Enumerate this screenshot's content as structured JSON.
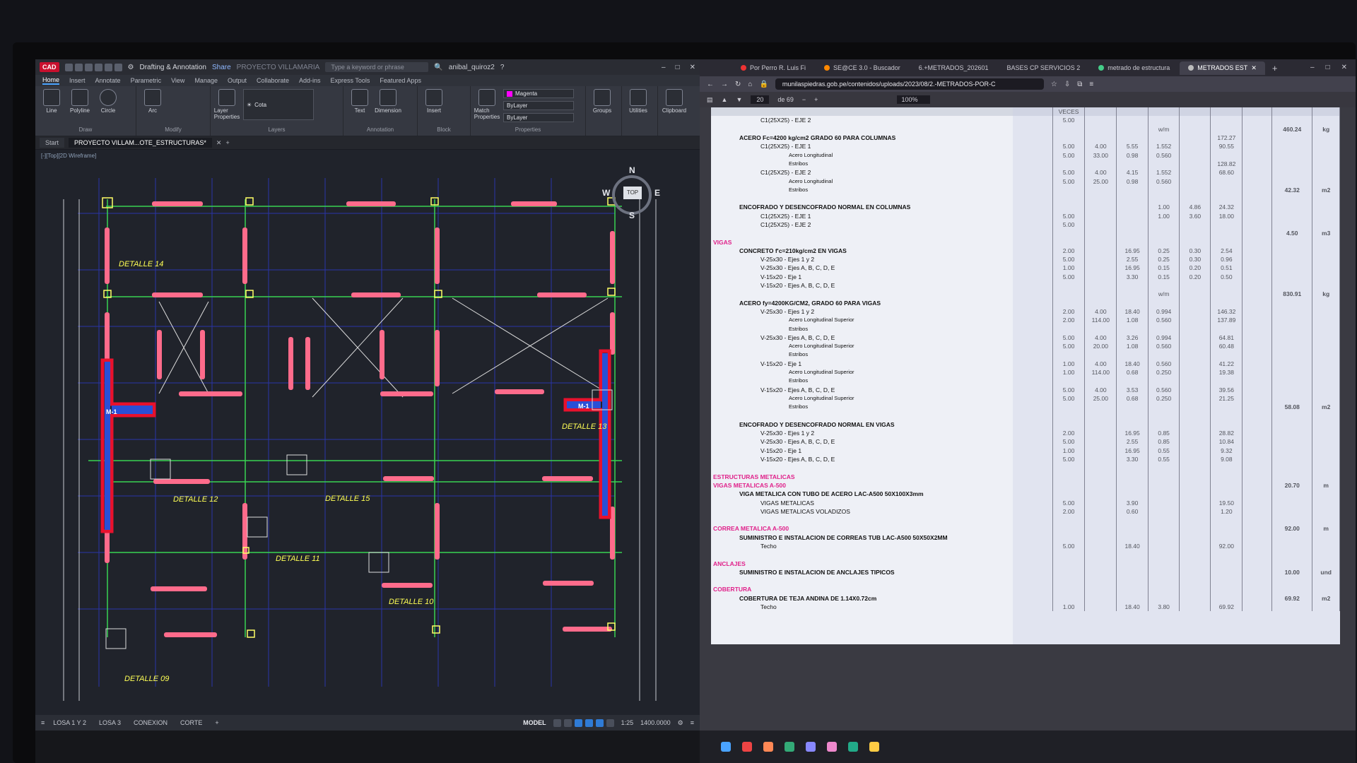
{
  "cad": {
    "app_badge": "CAD",
    "workspace": "Drafting & Annotation",
    "share": "Share",
    "file_title": "PROYECTO VILLAMARIA",
    "search_placeholder": "Type a keyword or phrase",
    "user": "anibal_quiroz2",
    "ribbon_tabs": [
      "Home",
      "Insert",
      "Annotate",
      "Parametric",
      "View",
      "Manage",
      "Output",
      "Collaborate",
      "Add-ins",
      "Express Tools",
      "Featured Apps"
    ],
    "draw_tools": [
      "Line",
      "Polyline",
      "Circle",
      "Arc"
    ],
    "group_draw": "Draw",
    "group_modify": "Modify",
    "layer_props": "Layer Properties",
    "layer_name": "Cota",
    "group_layers": "Layers",
    "annot_tools": [
      "Text",
      "Dimension"
    ],
    "group_annotation": "Annotation",
    "insert_label": "Insert",
    "group_block": "Block",
    "match_props": "Match Properties",
    "color_value": "Magenta",
    "bylayer1": "ByLayer",
    "bylayer2": "ByLayer",
    "group_properties": "Properties",
    "groups_label": "Groups",
    "utilities_label": "Utilities",
    "clipboard_label": "Clipboard",
    "doc_tab_start": "Start",
    "doc_tab_file": "PROYECTO VILLAM...OTE_ESTRUCTURAS*",
    "viewport_label": "[-][Top][2D Wireframe]",
    "details": [
      "DETALLE 14",
      "DETALLE 13",
      "DETALLE 12",
      "DETALLE 15",
      "DETALLE 11",
      "DETALLE 10",
      "DETALLE 09"
    ],
    "wall_label_left": "M-1",
    "wall_label_right": "M-1",
    "compass": {
      "n": "N",
      "s": "S",
      "e": "E",
      "w": "W",
      "top": "TOP"
    },
    "layout_tabs": [
      "LOSA 1 Y 2",
      "LOSA 3",
      "CONEXION",
      "CORTE"
    ],
    "model": "MODEL",
    "scale": "1:25",
    "coord": "1400.0000"
  },
  "browser": {
    "tabs": [
      "Por Perro R. Luis Fi",
      "SE@CE 3.0 - Buscador",
      "6.+METRADOS_202601",
      "BASES CP SERVICIOS 2",
      "metrado de estructura",
      "METRADOS EST"
    ],
    "url": "munilaspiedras.gob.pe/contenidos/uploads/2023/08/2.-METRADOS-POR-C",
    "page_current": "20",
    "page_total": "de 69",
    "zoom": "100%",
    "header_cols": [
      "VECES"
    ]
  },
  "sheet": {
    "rows": [
      {
        "d": "C1(25X25) - EJE 2",
        "l": "lvl2",
        "c": [
          "5.00",
          "",
          "",
          "",
          "",
          "",
          ""
        ],
        "t": "",
        "u": ""
      },
      {
        "d": "",
        "l": "",
        "c": [
          "",
          "",
          "",
          "w/m",
          "",
          "",
          ""
        ],
        "t": "460.24",
        "u": "kg"
      },
      {
        "d": "ACERO Fc=4200 kg/cm2 GRADO 60 PARA COLUMNAS",
        "l": "lvl1",
        "c": [
          "",
          "",
          "",
          "",
          "",
          "172.27",
          ""
        ],
        "t": "",
        "u": ""
      },
      {
        "d": "C1(25X25) - EJE 1",
        "l": "lvl2",
        "c": [
          "5.00",
          "4.00",
          "5.55",
          "1.552",
          "",
          "90.55",
          ""
        ],
        "t": "",
        "u": ""
      },
      {
        "d": "Acero Longitudinal",
        "l": "lvl3",
        "c": [
          "5.00",
          "33.00",
          "0.98",
          "0.560",
          "",
          "",
          ""
        ],
        "t": "",
        "u": ""
      },
      {
        "d": "Estribos",
        "l": "lvl3",
        "c": [
          "",
          "",
          "",
          "",
          "",
          "128.82",
          ""
        ],
        "t": "",
        "u": ""
      },
      {
        "d": "C1(25X25) - EJE 2",
        "l": "lvl2",
        "c": [
          "5.00",
          "4.00",
          "4.15",
          "1.552",
          "",
          "68.60",
          ""
        ],
        "t": "",
        "u": ""
      },
      {
        "d": "Acero Longitudinal",
        "l": "lvl3",
        "c": [
          "5.00",
          "25.00",
          "0.98",
          "0.560",
          "",
          "",
          ""
        ],
        "t": "",
        "u": ""
      },
      {
        "d": "Estribos",
        "l": "lvl3",
        "c": [
          "",
          "",
          "",
          "",
          "",
          "",
          ""
        ],
        "t": "42.32",
        "u": "m2"
      },
      {
        "d": "",
        "l": "",
        "c": [
          "",
          "",
          "",
          "",
          "",
          "",
          ""
        ],
        "t": "",
        "u": ""
      },
      {
        "d": "ENCOFRADO Y DESENCOFRADO NORMAL EN COLUMNAS",
        "l": "lvl1",
        "c": [
          "",
          "",
          "",
          "1.00",
          "4.86",
          "24.32",
          ""
        ],
        "t": "",
        "u": ""
      },
      {
        "d": "C1(25X25) - EJE 1",
        "l": "lvl2",
        "c": [
          "5.00",
          "",
          "",
          "1.00",
          "3.60",
          "18.00",
          ""
        ],
        "t": "",
        "u": ""
      },
      {
        "d": "C1(25X25) - EJE 2",
        "l": "lvl2",
        "c": [
          "5.00",
          "",
          "",
          "",
          "",
          "",
          ""
        ],
        "t": "",
        "u": ""
      },
      {
        "d": "",
        "l": "",
        "c": [
          "",
          "",
          "",
          "",
          "",
          "",
          ""
        ],
        "t": "4.50",
        "u": "m3"
      },
      {
        "d": "VIGAS",
        "l": "lvl0",
        "c": [
          "",
          "",
          "",
          "",
          "",
          "",
          ""
        ],
        "t": "",
        "u": ""
      },
      {
        "d": "CONCRETO f'c=210kg/cm2 EN VIGAS",
        "l": "lvl1",
        "c": [
          "2.00",
          "",
          "16.95",
          "0.25",
          "0.30",
          "2.54",
          ""
        ],
        "t": "",
        "u": ""
      },
      {
        "d": "V-25x30 - Ejes 1 y 2",
        "l": "lvl2",
        "c": [
          "5.00",
          "",
          "2.55",
          "0.25",
          "0.30",
          "0.96",
          ""
        ],
        "t": "",
        "u": ""
      },
      {
        "d": "V-25x30 - Ejes A, B, C, D, E",
        "l": "lvl2",
        "c": [
          "1.00",
          "",
          "16.95",
          "0.15",
          "0.20",
          "0.51",
          ""
        ],
        "t": "",
        "u": ""
      },
      {
        "d": "V-15x20 - Eje 1",
        "l": "lvl2",
        "c": [
          "5.00",
          "",
          "3.30",
          "0.15",
          "0.20",
          "0.50",
          ""
        ],
        "t": "",
        "u": ""
      },
      {
        "d": "V-15x20 - Ejes A, B, C, D, E",
        "l": "lvl2",
        "c": [
          "",
          "",
          "",
          "",
          "",
          "",
          ""
        ],
        "t": "",
        "u": ""
      },
      {
        "d": "",
        "l": "",
        "c": [
          "",
          "",
          "",
          "w/m",
          "",
          "",
          ""
        ],
        "t": "830.91",
        "u": "kg"
      },
      {
        "d": "ACERO fy=4200KG/CM2, GRADO 60 PARA VIGAS",
        "l": "lvl1",
        "c": [
          "",
          "",
          "",
          "",
          "",
          "",
          ""
        ],
        "t": "",
        "u": ""
      },
      {
        "d": "V-25x30 - Ejes 1 y 2",
        "l": "lvl2",
        "c": [
          "2.00",
          "4.00",
          "18.40",
          "0.994",
          "",
          "146.32",
          ""
        ],
        "t": "",
        "u": ""
      },
      {
        "d": "Acero Longitudinal Superior",
        "l": "lvl3",
        "c": [
          "2.00",
          "114.00",
          "1.08",
          "0.560",
          "",
          "137.89",
          ""
        ],
        "t": "",
        "u": ""
      },
      {
        "d": "Estribos",
        "l": "lvl3",
        "c": [
          "",
          "",
          "",
          "",
          "",
          "",
          ""
        ],
        "t": "",
        "u": ""
      },
      {
        "d": "V-25x30 - Ejes A, B, C, D, E",
        "l": "lvl2",
        "c": [
          "5.00",
          "4.00",
          "3.26",
          "0.994",
          "",
          "64.81",
          ""
        ],
        "t": "",
        "u": ""
      },
      {
        "d": "Acero Longitudinal Superior",
        "l": "lvl3",
        "c": [
          "5.00",
          "20.00",
          "1.08",
          "0.560",
          "",
          "60.48",
          ""
        ],
        "t": "",
        "u": ""
      },
      {
        "d": "Estribos",
        "l": "lvl3",
        "c": [
          "",
          "",
          "",
          "",
          "",
          "",
          ""
        ],
        "t": "",
        "u": ""
      },
      {
        "d": "V-15x20 - Eje 1",
        "l": "lvl2",
        "c": [
          "1.00",
          "4.00",
          "18.40",
          "0.560",
          "",
          "41.22",
          ""
        ],
        "t": "",
        "u": ""
      },
      {
        "d": "Acero Longitudinal Superior",
        "l": "lvl3",
        "c": [
          "1.00",
          "114.00",
          "0.68",
          "0.250",
          "",
          "19.38",
          ""
        ],
        "t": "",
        "u": ""
      },
      {
        "d": "Estribos",
        "l": "lvl3",
        "c": [
          "",
          "",
          "",
          "",
          "",
          "",
          ""
        ],
        "t": "",
        "u": ""
      },
      {
        "d": "V-15x20 - Ejes A, B, C, D, E",
        "l": "lvl2",
        "c": [
          "5.00",
          "4.00",
          "3.53",
          "0.560",
          "",
          "39.56",
          ""
        ],
        "t": "",
        "u": ""
      },
      {
        "d": "Acero Longitudinal Superior",
        "l": "lvl3",
        "c": [
          "5.00",
          "25.00",
          "0.68",
          "0.250",
          "",
          "21.25",
          ""
        ],
        "t": "",
        "u": ""
      },
      {
        "d": "Estribos",
        "l": "lvl3",
        "c": [
          "",
          "",
          "",
          "",
          "",
          "",
          ""
        ],
        "t": "58.08",
        "u": "m2"
      },
      {
        "d": "",
        "l": "",
        "c": [
          "",
          "",
          "",
          "",
          "",
          "",
          ""
        ],
        "t": "",
        "u": ""
      },
      {
        "d": "ENCOFRADO Y DESENCOFRADO NORMAL EN VIGAS",
        "l": "lvl1",
        "c": [
          "",
          "",
          "",
          "",
          "",
          "",
          ""
        ],
        "t": "",
        "u": ""
      },
      {
        "d": "V-25x30 - Ejes 1 y 2",
        "l": "lvl2",
        "c": [
          "2.00",
          "",
          "16.95",
          "0.85",
          "",
          "28.82",
          ""
        ],
        "t": "",
        "u": ""
      },
      {
        "d": "V-25x30 - Ejes A, B, C, D, E",
        "l": "lvl2",
        "c": [
          "5.00",
          "",
          "2.55",
          "0.85",
          "",
          "10.84",
          ""
        ],
        "t": "",
        "u": ""
      },
      {
        "d": "V-15x20 - Eje 1",
        "l": "lvl2",
        "c": [
          "1.00",
          "",
          "16.95",
          "0.55",
          "",
          "9.32",
          ""
        ],
        "t": "",
        "u": ""
      },
      {
        "d": "V-15x20 - Ejes A, B, C, D, E",
        "l": "lvl2",
        "c": [
          "5.00",
          "",
          "3.30",
          "0.55",
          "",
          "9.08",
          ""
        ],
        "t": "",
        "u": ""
      },
      {
        "d": "",
        "l": "",
        "c": [
          "",
          "",
          "",
          "",
          "",
          "",
          ""
        ],
        "t": "",
        "u": ""
      },
      {
        "d": "ESTRUCTURAS METALICAS",
        "l": "lvl0",
        "c": [
          "",
          "",
          "",
          "",
          "",
          "",
          ""
        ],
        "t": "",
        "u": ""
      },
      {
        "d": "VIGAS METALICAS A-500",
        "l": "lvl0",
        "c": [
          "",
          "",
          "",
          "",
          "",
          "",
          ""
        ],
        "t": "20.70",
        "u": "m"
      },
      {
        "d": "VIGA METALICA CON TUBO DE ACERO LAC-A500 50X100X3mm",
        "l": "lvl1",
        "c": [
          "",
          "",
          "",
          "",
          "",
          "",
          ""
        ],
        "t": "",
        "u": ""
      },
      {
        "d": "VIGAS METALICAS",
        "l": "lvl2",
        "c": [
          "5.00",
          "",
          "3.90",
          "",
          "",
          "19.50",
          ""
        ],
        "t": "",
        "u": ""
      },
      {
        "d": "VIGAS METALICAS VOLADIZOS",
        "l": "lvl2",
        "c": [
          "2.00",
          "",
          "0.60",
          "",
          "",
          "1.20",
          ""
        ],
        "t": "",
        "u": ""
      },
      {
        "d": "",
        "l": "",
        "c": [
          "",
          "",
          "",
          "",
          "",
          "",
          ""
        ],
        "t": "",
        "u": ""
      },
      {
        "d": "CORREA METALICA A-500",
        "l": "lvl0",
        "c": [
          "",
          "",
          "",
          "",
          "",
          "",
          ""
        ],
        "t": "92.00",
        "u": "m"
      },
      {
        "d": "SUMINISTRO E INSTALACION DE CORREAS TUB LAC-A500 50X50X2MM",
        "l": "lvl1",
        "c": [
          "",
          "",
          "",
          "",
          "",
          "",
          ""
        ],
        "t": "",
        "u": ""
      },
      {
        "d": "Techo",
        "l": "lvl2",
        "c": [
          "5.00",
          "",
          "18.40",
          "",
          "",
          "92.00",
          ""
        ],
        "t": "",
        "u": ""
      },
      {
        "d": "",
        "l": "",
        "c": [
          "",
          "",
          "",
          "",
          "",
          "",
          ""
        ],
        "t": "",
        "u": ""
      },
      {
        "d": "ANCLAJES",
        "l": "lvl0",
        "c": [
          "",
          "",
          "",
          "",
          "",
          "",
          ""
        ],
        "t": "",
        "u": ""
      },
      {
        "d": "SUMINISTRO E INSTALACION DE ANCLAJES TIPICOS",
        "l": "lvl1",
        "c": [
          "",
          "",
          "",
          "",
          "",
          "",
          ""
        ],
        "t": "10.00",
        "u": "und"
      },
      {
        "d": "",
        "l": "",
        "c": [
          "",
          "",
          "",
          "",
          "",
          "",
          ""
        ],
        "t": "",
        "u": ""
      },
      {
        "d": "COBERTURA",
        "l": "lvl0",
        "c": [
          "",
          "",
          "",
          "",
          "",
          "",
          ""
        ],
        "t": "",
        "u": ""
      },
      {
        "d": "COBERTURA DE TEJA ANDINA DE 1.14X0.72cm",
        "l": "lvl1",
        "c": [
          "",
          "",
          "",
          "",
          "",
          "",
          ""
        ],
        "t": "69.92",
        "u": "m2"
      },
      {
        "d": "Techo",
        "l": "lvl2",
        "c": [
          "1.00",
          "",
          "18.40",
          "3.80",
          "",
          "69.92",
          ""
        ],
        "t": "",
        "u": ""
      }
    ]
  },
  "colors": {
    "cad_bg": "#20232b",
    "beam": "#ff6b8b",
    "column": "#ffff66",
    "grid": "#39d353",
    "wall": "#e8112d",
    "detail": "#ffff55",
    "sheet_pink": "#e0218a"
  }
}
